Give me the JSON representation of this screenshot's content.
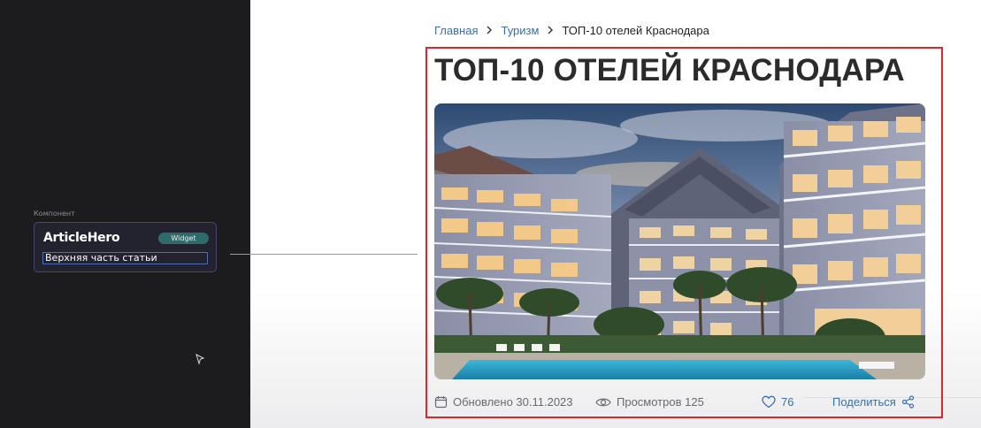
{
  "design_panel": {
    "component_label": "Компонент",
    "component_name": "ArticleHero",
    "badge": "Widget",
    "description": "Верхняя часть статьи"
  },
  "breadcrumb": {
    "items": [
      "Главная",
      "Туризм"
    ],
    "current": "ТОП-10 отелей Краснодара"
  },
  "article": {
    "title": "ТОП-10 ОТЕЛЕЙ КРАСНОДАРА",
    "updated": "Обновлено 30.11.2023",
    "views": "Просмотров 125",
    "likes": "76",
    "share": "Поделиться"
  },
  "colors": {
    "highlight_frame": "#e0262d",
    "link": "#3b6ea8",
    "badge": "#2f6b6a",
    "panel": "#1c1c1e"
  },
  "icons": [
    "calendar-icon",
    "eye-icon",
    "heart-icon",
    "share-icon",
    "chevron-right-icon",
    "cursor-icon"
  ]
}
